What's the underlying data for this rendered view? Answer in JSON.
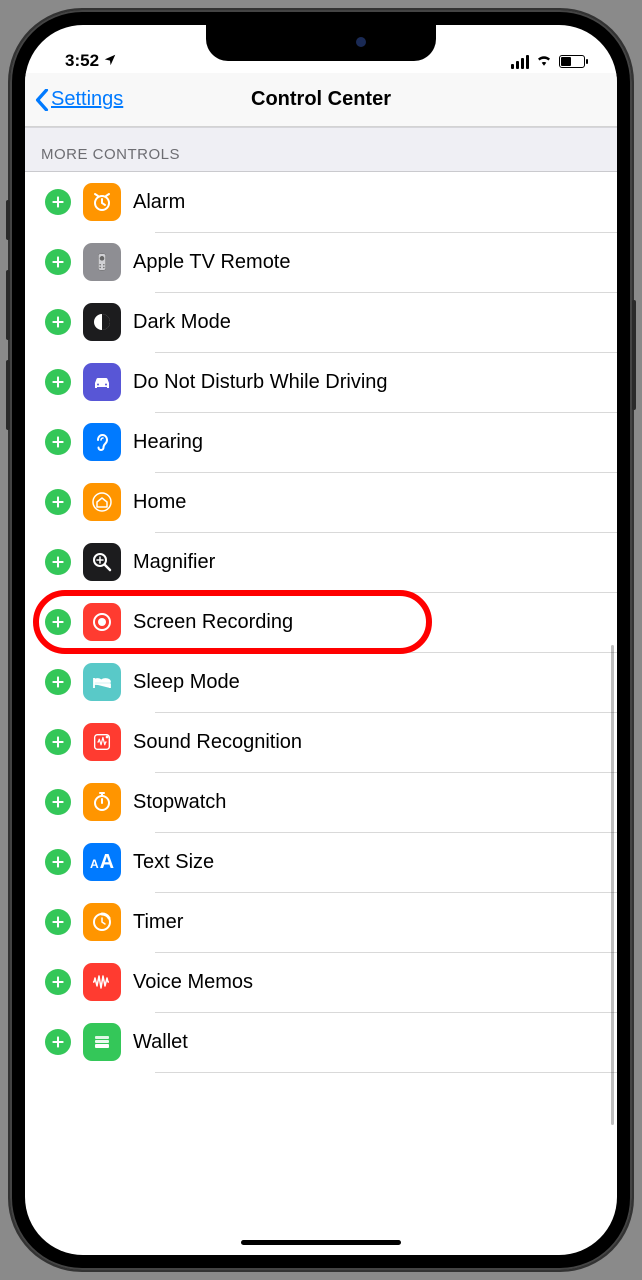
{
  "status": {
    "time": "3:52",
    "location_arrow": "➤"
  },
  "nav": {
    "back_label": "Settings",
    "title": "Control Center"
  },
  "section": {
    "more_controls": "MORE CONTROLS"
  },
  "controls": [
    {
      "label": "Alarm",
      "icon": "alarm-icon",
      "cls": "ic-alarm"
    },
    {
      "label": "Apple TV Remote",
      "icon": "appletv-remote-icon",
      "cls": "ic-appletv"
    },
    {
      "label": "Dark Mode",
      "icon": "dark-mode-icon",
      "cls": "ic-darkmode"
    },
    {
      "label": "Do Not Disturb While Driving",
      "icon": "car-icon",
      "cls": "ic-dnd"
    },
    {
      "label": "Hearing",
      "icon": "ear-icon",
      "cls": "ic-hearing"
    },
    {
      "label": "Home",
      "icon": "home-icon",
      "cls": "ic-home"
    },
    {
      "label": "Magnifier",
      "icon": "magnifier-icon",
      "cls": "ic-magnifier"
    },
    {
      "label": "Screen Recording",
      "icon": "screen-recording-icon",
      "cls": "ic-screenrec",
      "highlighted": true
    },
    {
      "label": "Sleep Mode",
      "icon": "bed-icon",
      "cls": "ic-sleepmode"
    },
    {
      "label": "Sound Recognition",
      "icon": "sound-recognition-icon",
      "cls": "ic-soundrec"
    },
    {
      "label": "Stopwatch",
      "icon": "stopwatch-icon",
      "cls": "ic-stopwatch"
    },
    {
      "label": "Text Size",
      "icon": "text-size-icon",
      "cls": "ic-textsize"
    },
    {
      "label": "Timer",
      "icon": "timer-icon",
      "cls": "ic-timer"
    },
    {
      "label": "Voice Memos",
      "icon": "voice-memos-icon",
      "cls": "ic-voicememos"
    },
    {
      "label": "Wallet",
      "icon": "wallet-icon",
      "cls": "ic-wallet"
    }
  ]
}
